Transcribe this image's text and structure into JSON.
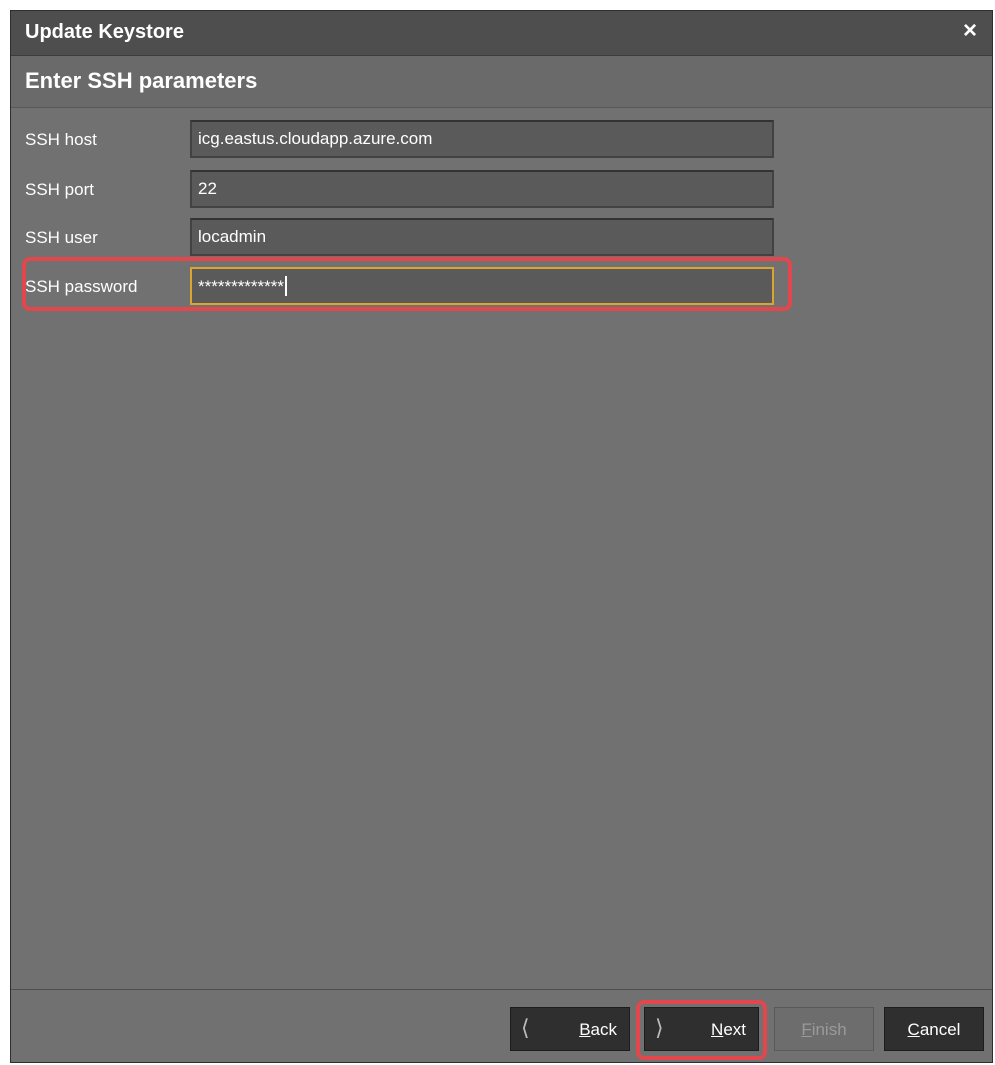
{
  "window": {
    "title": "Update Keystore",
    "close_symbol": "×"
  },
  "step": {
    "title": "Enter SSH parameters"
  },
  "form": {
    "host": {
      "label": "SSH host",
      "value": "icg.eastus.cloudapp.azure.com"
    },
    "port": {
      "label": "SSH port",
      "value": "22"
    },
    "user": {
      "label": "SSH user",
      "value": "locadmin"
    },
    "password": {
      "label": "SSH password",
      "value": "*************",
      "focused": true
    }
  },
  "buttons": {
    "back": {
      "mnemonic": "B",
      "rest": "ack",
      "enabled": true
    },
    "next": {
      "mnemonic": "N",
      "rest": "ext",
      "enabled": true,
      "highlighted": true
    },
    "finish": {
      "mnemonic": "F",
      "rest": "inish",
      "enabled": false
    },
    "cancel": {
      "mnemonic": "C",
      "rest": "ancel",
      "enabled": true
    }
  },
  "icons": {
    "back": "chevron-left-icon",
    "next": "chevron-right-icon",
    "close": "close-icon"
  },
  "colors": {
    "dialog_bg": "#717171",
    "titlebar_bg": "#4e4e4e",
    "focus_border": "#d8a530",
    "annotation_red": "#e1474d"
  }
}
